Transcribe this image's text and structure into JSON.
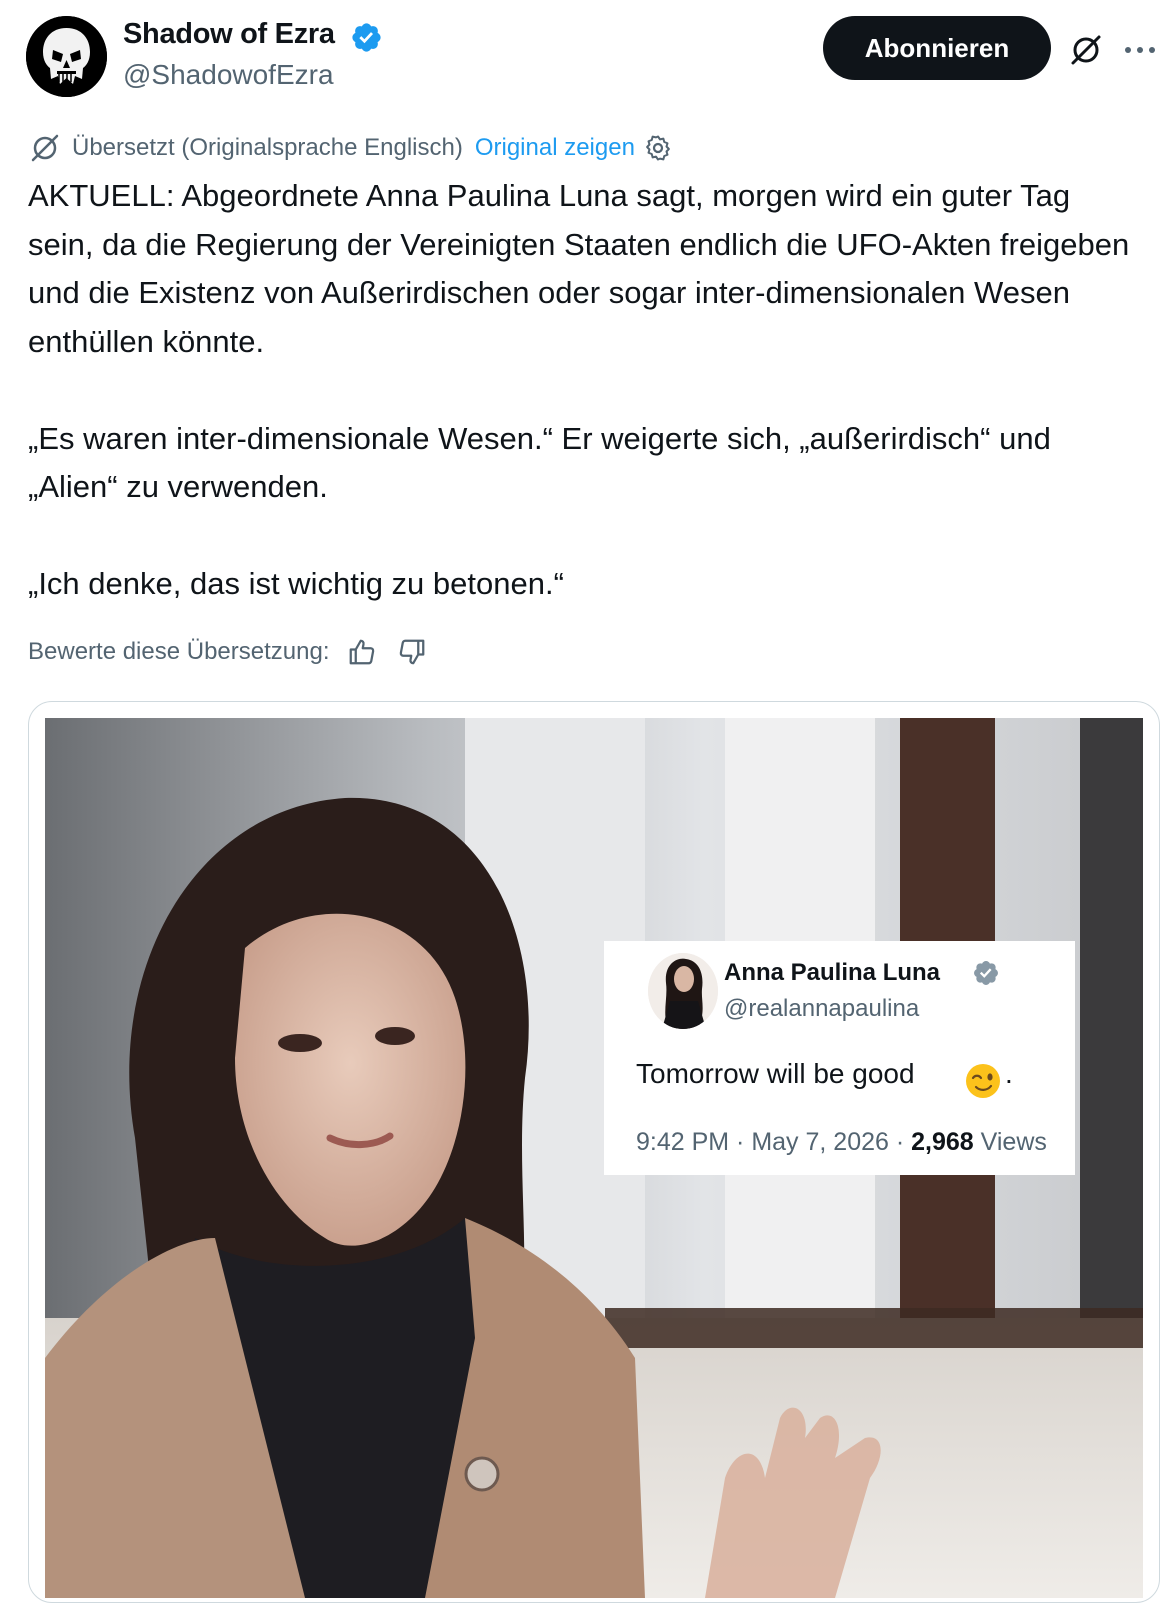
{
  "author": {
    "display_name": "Shadow of Ezra",
    "handle": "@ShadowofEzra"
  },
  "actions": {
    "subscribe_label": "Abonnieren"
  },
  "translation": {
    "notice": "Übersetzt (Originalsprache Englisch)",
    "show_original": "Original zeigen",
    "rate_label": "Bewerte diese Übersetzung:"
  },
  "tweet": {
    "paragraph_1": "AKTUELL: Abgeordnete Anna Paulina Luna sagt, morgen wird ein guter Tag sein, da die Regierung der Vereinigten Staaten endlich die UFO-Akten freigeben und die Existenz von Außerirdischen oder sogar inter-dimensionalen Wesen enthüllen könnte.",
    "paragraph_2": "„Es waren inter-dimensionale Wesen.“ Er weigerte sich, „außerirdisch“ und „Alien“ zu verwenden.",
    "paragraph_3": "„Ich denke, das ist wichtig zu betonen.“"
  },
  "embedded_tweet": {
    "name": "Anna Paulina Luna",
    "handle": "@realannapaulina",
    "text": "Tomorrow will be good",
    "punctuation": ".",
    "time": "9:42 PM · May 7, 2026 · ",
    "views_count": "2,968",
    "views_label": " Views"
  },
  "colors": {
    "accent": "#1d9bf0",
    "text_primary": "#0f1419",
    "text_secondary": "#536471",
    "button_dark": "#0f1419",
    "border": "#cfd9de"
  },
  "icons": {
    "verified": "verified-badge-icon",
    "grok": "grok-icon",
    "more": "more-icon",
    "translate": "translate-icon",
    "settings": "gear-icon",
    "thumbs_up": "thumbs-up-icon",
    "thumbs_down": "thumbs-down-icon",
    "emoji": "winking-face-emoji"
  }
}
